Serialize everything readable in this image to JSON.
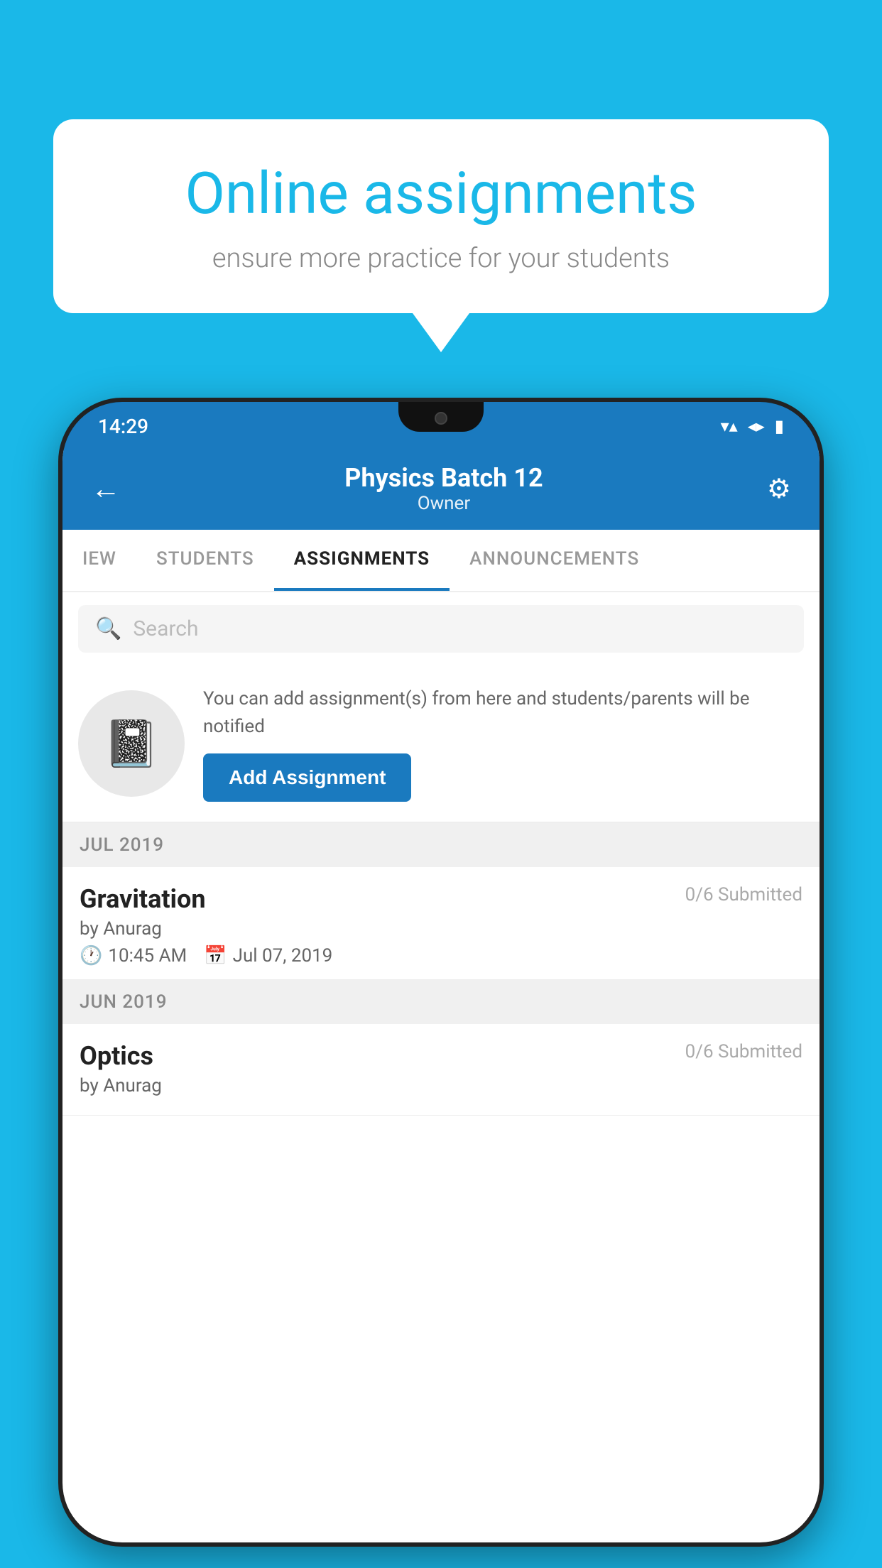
{
  "background": {
    "color": "#1ab8e8"
  },
  "speech_bubble": {
    "title": "Online assignments",
    "subtitle": "ensure more practice for your students"
  },
  "phone": {
    "status_bar": {
      "time": "14:29",
      "signal_icon": "▼▲",
      "battery_icon": "▮"
    },
    "header": {
      "title": "Physics Batch 12",
      "subtitle": "Owner",
      "back_label": "←",
      "settings_label": "⚙"
    },
    "tabs": [
      {
        "label": "IEW",
        "active": false
      },
      {
        "label": "STUDENTS",
        "active": false
      },
      {
        "label": "ASSIGNMENTS",
        "active": true
      },
      {
        "label": "ANNOUNCEMENTS",
        "active": false
      }
    ],
    "search": {
      "placeholder": "Search"
    },
    "info_card": {
      "description": "You can add assignment(s) from here and students/parents will be notified",
      "button_label": "Add Assignment"
    },
    "sections": [
      {
        "label": "JUL 2019",
        "assignments": [
          {
            "name": "Gravitation",
            "submitted": "0/6 Submitted",
            "by": "by Anurag",
            "time": "10:45 AM",
            "date": "Jul 07, 2019"
          }
        ]
      },
      {
        "label": "JUN 2019",
        "assignments": [
          {
            "name": "Optics",
            "submitted": "0/6 Submitted",
            "by": "by Anurag",
            "time": "",
            "date": ""
          }
        ]
      }
    ]
  }
}
